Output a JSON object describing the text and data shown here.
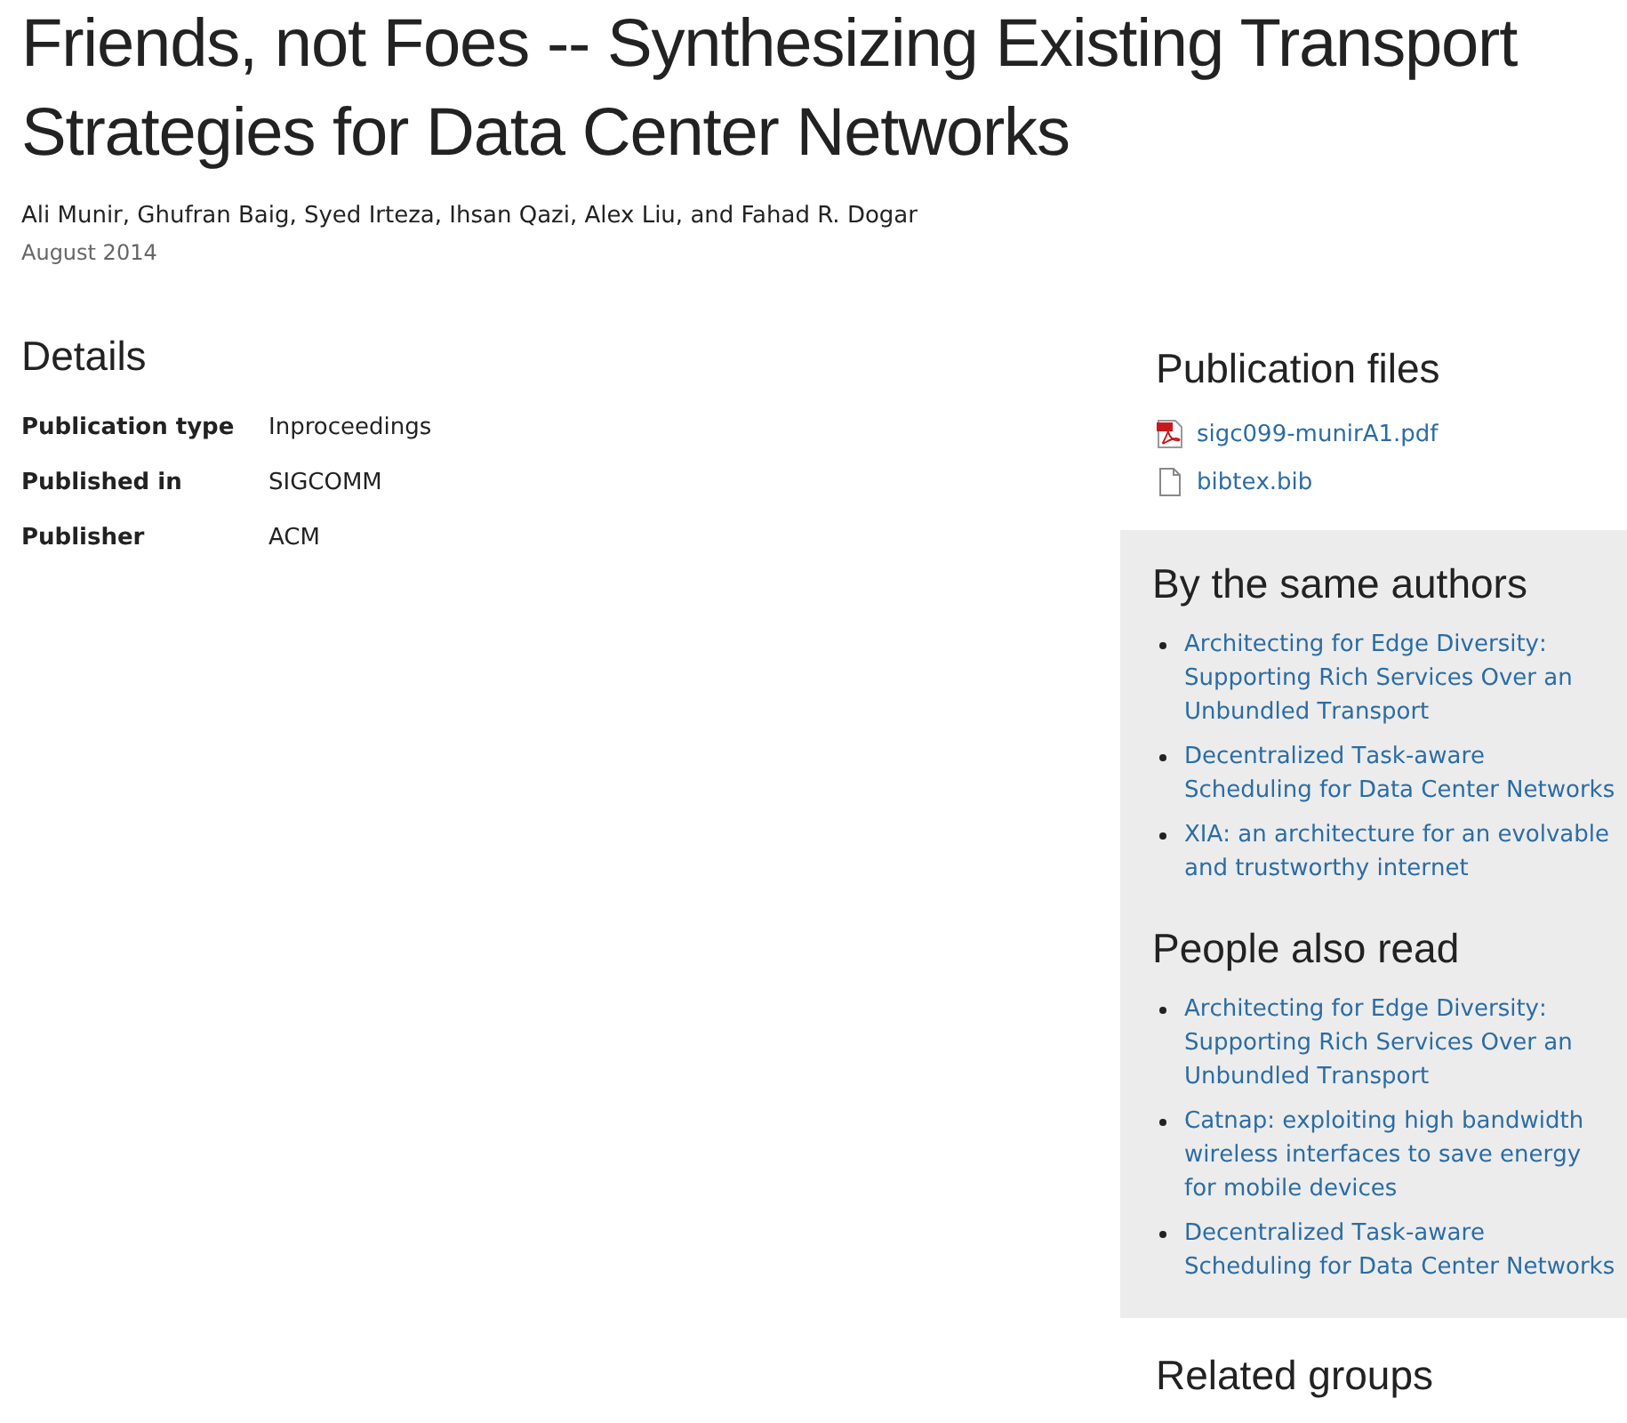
{
  "title": "Friends, not Foes -- Synthesizing Existing Transport Strategies for Data Center Networks",
  "authors": "Ali Munir, Ghufran Baig, Syed Irteza, Ihsan Qazi, Alex Liu, and Fahad R. Dogar",
  "date": "August 2014",
  "details": {
    "heading": "Details",
    "rows": [
      {
        "label": "Publication type",
        "value": "Inproceedings"
      },
      {
        "label": "Published in",
        "value": "SIGCOMM"
      },
      {
        "label": "Publisher",
        "value": "ACM"
      }
    ]
  },
  "publication_files": {
    "heading": "Publication files",
    "files": [
      {
        "name": "sigc099-munirA1.pdf",
        "kind": "pdf"
      },
      {
        "name": "bibtex.bib",
        "kind": "file"
      }
    ]
  },
  "by_the_same_authors": {
    "heading": "By the same authors",
    "links": [
      "Architecting for Edge Diversity: Supporting Rich Services Over an Unbundled Transport",
      "Decentralized Task-aware Scheduling for Data Center Networks",
      "XIA: an architecture for an evolvable and trustworthy internet"
    ]
  },
  "people_also_read": {
    "heading": "People also read",
    "links": [
      "Architecting for Edge Diversity: Supporting Rich Services Over an Unbundled Transport",
      "Catnap: exploiting high bandwidth wireless interfaces to save energy for mobile devices",
      "Decentralized Task-aware Scheduling for Data Center Networks"
    ]
  },
  "related_groups": {
    "heading": "Related groups"
  }
}
